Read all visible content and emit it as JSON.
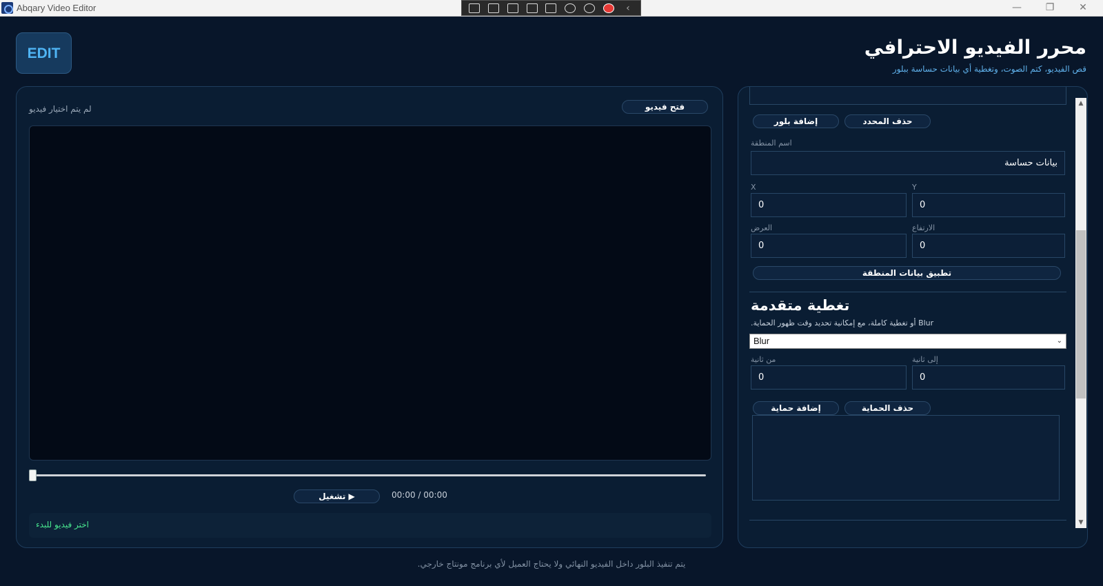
{
  "window": {
    "title": "Abqary Video Editor",
    "minimize_icon": "minimize-icon",
    "restore_icon": "restore-icon",
    "close_icon": "close-icon"
  },
  "capture_toolbar": {
    "icons": [
      "screenshot-menu-icon",
      "video-record-icon",
      "pointer-icon",
      "frame-icon",
      "crop-icon",
      "audio-icon",
      "accessibility-icon",
      "stop-icon",
      "collapse-chevron-icon"
    ]
  },
  "header": {
    "logo": "EDIT",
    "title": "محرر الفيديو الاحترافي",
    "subtitle": "قص الفيديو، كتم الصوت، وتغطية أي بيانات حساسة ببلور"
  },
  "video_panel": {
    "open_button": "فتح فيديو",
    "status": "لم يتم اختيار فيديو",
    "time": "00:00 / 00:00",
    "play_button": "▶  تشغيل",
    "status_message": "اختر فيديو للبدء"
  },
  "blur_panel": {
    "add_blur_button": "إضافة بلور",
    "delete_selected_button": "حذف المحدد",
    "region_name_label": "اسم المنطقة",
    "region_name_value": "بيانات حساسة",
    "x_label": "X",
    "x_value": "0",
    "y_label": "Y",
    "y_value": "0",
    "width_label": "العرض",
    "width_value": "0",
    "height_label": "الارتفاع",
    "height_value": "0",
    "apply_button": "تطبيق بيانات المنطقة"
  },
  "advanced_cover": {
    "title": "تغطية متقدمة",
    "description": "Blur أو تغطية كاملة، مع إمكانية تحديد وقت ظهور الحماية.",
    "mode_selected": "Blur",
    "from_label": "من ثانية",
    "from_value": "0",
    "to_label": "إلى ثانية",
    "to_value": "0",
    "add_protection_button": "إضافة حماية",
    "delete_protection_button": "حذف الحماية"
  },
  "footer": {
    "note": "يتم تنفيذ البلور داخل الفيديو النهائي ولا يحتاج العميل لأي برنامج مونتاج خارجي."
  },
  "colors": {
    "background": "#08162a",
    "panel": "#0a1d33",
    "accent_blue": "#4fb4f4",
    "status_green": "#48e58e"
  }
}
